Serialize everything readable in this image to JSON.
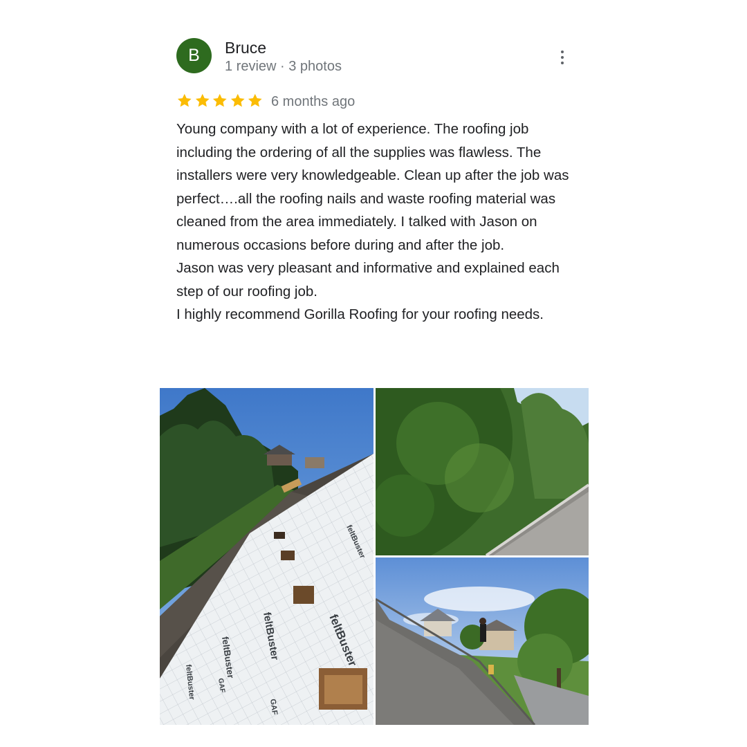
{
  "reviewer": {
    "initial": "B",
    "name": "Bruce",
    "meta": "1 review · 3 photos",
    "avatar_color": "#2e6b1f"
  },
  "menu": {
    "icon": "more-vert-icon"
  },
  "rating": {
    "stars": 5,
    "max": 5,
    "star_color": "#fbbc04",
    "age": "6 months ago"
  },
  "review_paragraphs": [
    "Young company with a lot of experience. The roofing job including the ordering of all the supplies was flawless. The installers were very knowledgeable. Clean up after the job was perfect….all the roofing nails and waste roofing material was cleaned from the area immediately. I talked with Jason on numerous occasions before during and after the job.",
    "Jason was very pleasant and informative and explained each step of our roofing job.",
    "I highly recommend Gorilla Roofing for your roofing needs."
  ],
  "photos": {
    "p1": {
      "wrap_brand": "feltBuster",
      "wrap_mark": "GAF"
    },
    "p2": {},
    "p3": {}
  }
}
